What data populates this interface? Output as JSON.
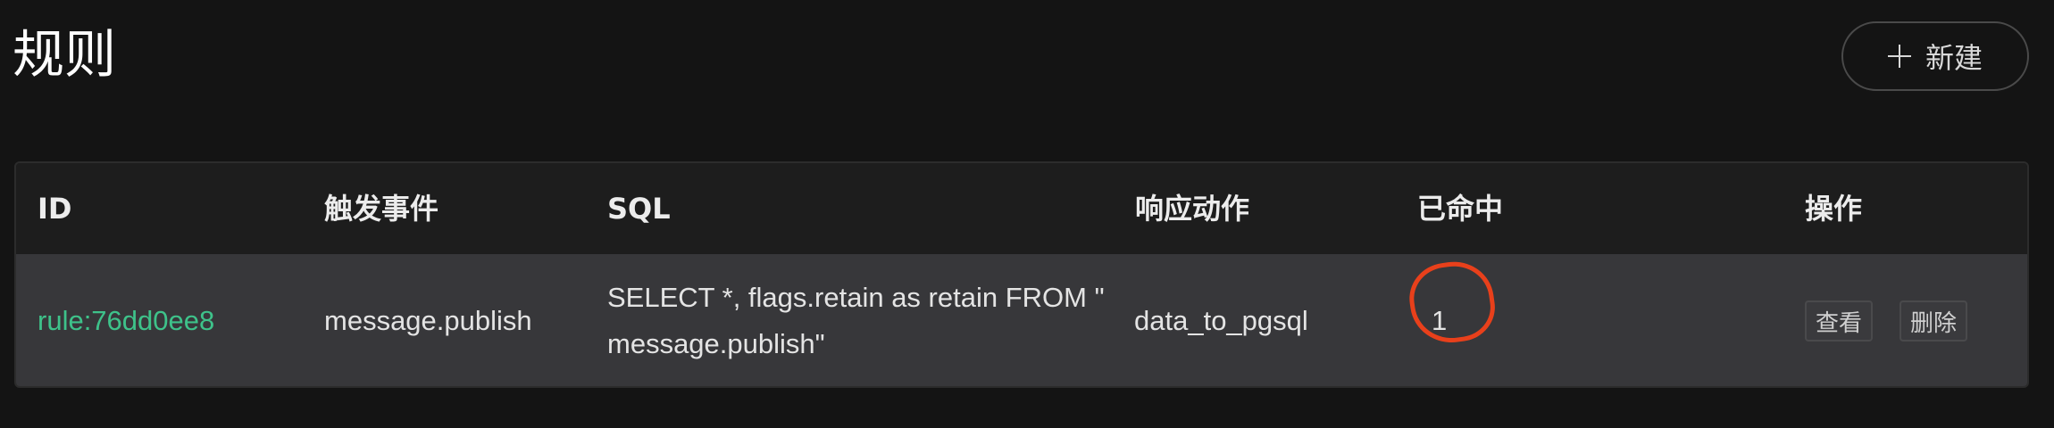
{
  "page": {
    "title": "规则",
    "new_button_label": "新建"
  },
  "table": {
    "headers": {
      "id": "ID",
      "trigger_event": "触发事件",
      "sql": "SQL",
      "action": "响应动作",
      "hits": "已命中",
      "operations": "操作"
    },
    "rows": [
      {
        "id": "rule:76dd0ee8",
        "trigger_event": "message.publish",
        "sql": "SELECT *, flags.retain as retain FROM \" message.publish\"",
        "action": "data_to_pgsql",
        "hits": "1",
        "view_label": "查看",
        "delete_label": "删除"
      }
    ]
  },
  "colors": {
    "background": "#141414",
    "link": "#3ec28a",
    "annotation": "#e8401b"
  }
}
